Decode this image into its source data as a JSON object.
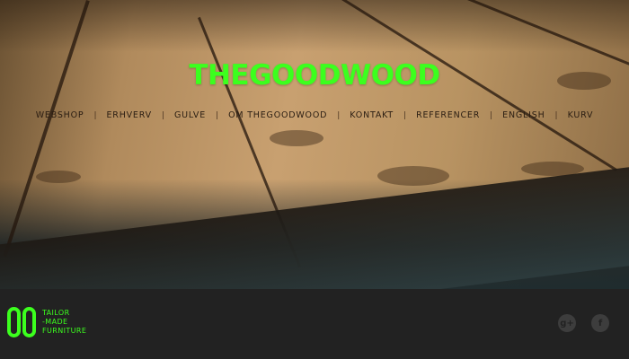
{
  "brand": {
    "name": "THEGOODWOOD",
    "tagline": [
      "TAILOR",
      "-MADE",
      "FURNITURE"
    ]
  },
  "nav": {
    "items": [
      "WEBSHOP",
      "ERHVERV",
      "GULVE",
      "OM THEGOODWOOD",
      "KONTAKT",
      "REFERENCER",
      "ENGLISH",
      "KURV"
    ],
    "separator": "|"
  },
  "social": {
    "google": "g+",
    "facebook": "f",
    "icons": [
      "google-plus-icon",
      "facebook-icon"
    ]
  },
  "colors": {
    "accent": "#3cff1e",
    "footer_bg": "#222222",
    "nav_text": "#2a1d12"
  }
}
